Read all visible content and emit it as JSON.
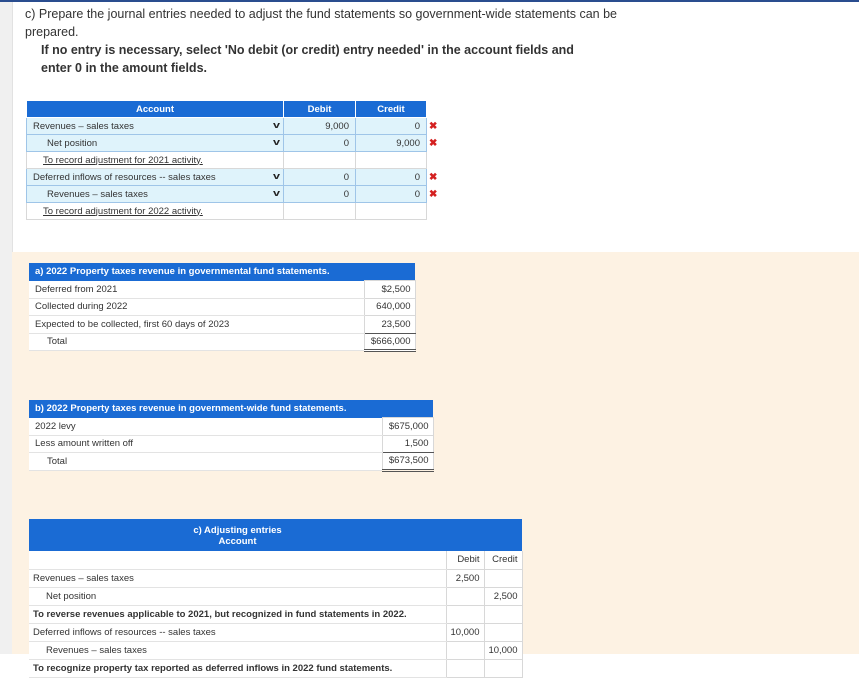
{
  "question": {
    "line": "c) Prepare the journal entries needed to adjust the fund statements so government-wide statements can be prepared.",
    "instruction": "If no entry is necessary, select 'No debit (or credit) entry needed' in the account fields and enter 0 in the amount fields."
  },
  "journal": {
    "headers": {
      "account": "Account",
      "debit": "Debit",
      "credit": "Credit"
    },
    "rows": [
      {
        "account": "Revenues – sales taxes",
        "debit": "9,000",
        "credit": "0",
        "wrong": "✖"
      },
      {
        "account": "Net position",
        "debit": "0",
        "credit": "9,000",
        "wrong": "✖"
      },
      {
        "account": "To record adjustment for 2021 activity."
      },
      {
        "account": "Deferred inflows of resources -- sales taxes",
        "debit": "0",
        "credit": "0",
        "wrong": "✖"
      },
      {
        "account": "Revenues – sales taxes",
        "debit": "0",
        "credit": "0",
        "wrong": "✖"
      },
      {
        "account": "To record adjustment for 2022 activity."
      }
    ]
  },
  "panel_a": {
    "title": "a) 2022 Property taxes revenue in governmental fund statements.",
    "rows": [
      {
        "label": "Deferred from 2021",
        "value": "$2,500"
      },
      {
        "label": "Collected during 2022",
        "value": "640,000"
      },
      {
        "label": "Expected to be collected, first 60 days of 2023",
        "value": "23,500"
      },
      {
        "label": "Total",
        "value": "$666,000"
      }
    ]
  },
  "panel_b": {
    "title": "b) 2022 Property taxes revenue in government-wide fund statements.",
    "rows": [
      {
        "label": "2022 levy",
        "value": "$675,000"
      },
      {
        "label": "Less amount written off",
        "value": "1,500"
      },
      {
        "label": "Total",
        "value": "$673,500"
      }
    ]
  },
  "panel_c": {
    "title": "c) Adjusting entries",
    "account_header": "Account",
    "debit_header": "Debit",
    "credit_header": "Credit",
    "rows": [
      {
        "label": "Revenues – sales taxes",
        "debit": "2,500",
        "credit": ""
      },
      {
        "label": "Net position",
        "debit": "",
        "credit": "2,500"
      },
      {
        "label": "To reverse revenues applicable to 2021, but recognized in fund statements in 2022.",
        "debit": "",
        "credit": ""
      },
      {
        "label": "Deferred inflows of resources -- sales taxes",
        "debit": "10,000",
        "credit": ""
      },
      {
        "label": "Revenues – sales taxes",
        "debit": "",
        "credit": "10,000"
      },
      {
        "label": "To recognize property tax reported as deferred inflows in 2022 fund statements.",
        "debit": "",
        "credit": ""
      }
    ]
  }
}
